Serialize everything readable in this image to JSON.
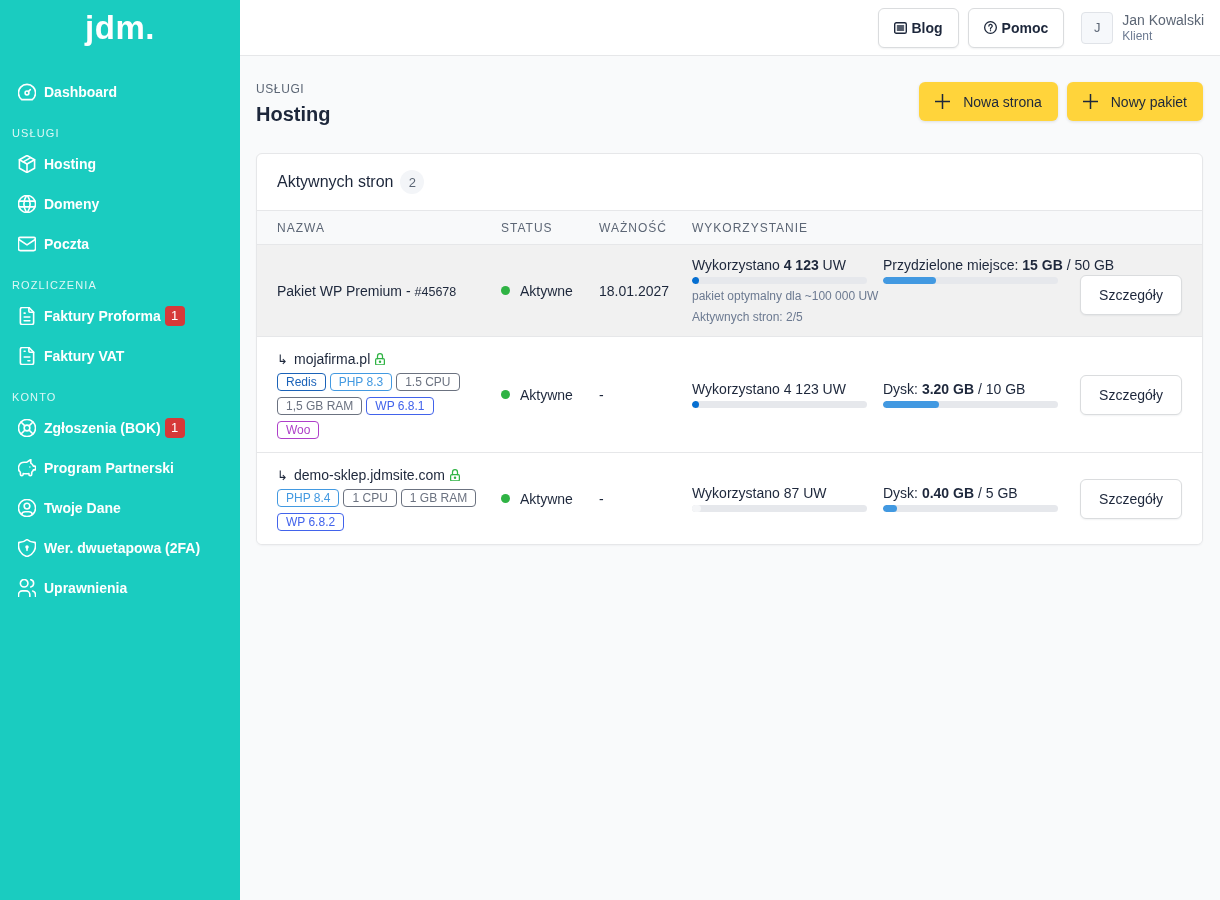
{
  "sidebar": {
    "logo": "jdm.",
    "sections": [
      {
        "items": [
          {
            "label": "Dashboard"
          }
        ]
      },
      {
        "title": "USŁUGI",
        "items": [
          {
            "label": "Hosting"
          },
          {
            "label": "Domeny"
          },
          {
            "label": "Poczta"
          }
        ]
      },
      {
        "title": "ROZLICZENIA",
        "items": [
          {
            "label": "Faktury Proforma",
            "badge": "1"
          },
          {
            "label": "Faktury VAT"
          }
        ]
      },
      {
        "title": "KONTO",
        "items": [
          {
            "label": "Zgłoszenia (BOK)",
            "badge": "1"
          },
          {
            "label": "Program Partnerski"
          },
          {
            "label": "Twoje Dane"
          },
          {
            "label": "Wer. dwuetapowa (2FA)"
          },
          {
            "label": "Uprawnienia"
          }
        ]
      }
    ]
  },
  "header": {
    "buttons": [
      {
        "label": "Blog"
      },
      {
        "label": "Pomoc"
      }
    ],
    "user": {
      "initial": "J",
      "name": "Jan Kowalski",
      "role": "Klient"
    }
  },
  "page": {
    "pretitle": "USŁUGI",
    "title": "Hosting",
    "actions": [
      {
        "label": "Nowa strona"
      },
      {
        "label": "Nowy pakiet"
      }
    ]
  },
  "card": {
    "title": "Aktywnych stron",
    "count": "2",
    "table": {
      "columns": [
        "NAZWA",
        "STATUS",
        "WAŻNOŚĆ",
        "WYKORZYSTANIE"
      ],
      "rows": [
        {
          "kind": "package",
          "name": "Pakiet WP Premium -",
          "id": "#45678",
          "status": {
            "label": "Aktywne",
            "color": "#2fb344"
          },
          "expiry": "18.01.2027",
          "usage": {
            "text": "Wykorzystano **4 123** UW",
            "level": 0.04,
            "color": "#066fd1",
            "notes": [
              "pakiet optymalny dla ~100 000 UW",
              "Aktywnych stron: 2/5"
            ]
          },
          "disk": {
            "text": "Przydzielone miejsce: **15 GB** / 50 GB",
            "level": 0.3
          },
          "action": "Szczegóły"
        },
        {
          "kind": "site",
          "arrow": "↳",
          "name": "mojafirma.pl",
          "ssl": true,
          "tags": [
            {
              "label": "Redis",
              "color": "#1a62b8"
            },
            {
              "label": "PHP 8.3",
              "color": "#4299e1"
            },
            {
              "label": "1.5 CPU",
              "color": "#6b7280"
            },
            {
              "label": "1,5 GB RAM",
              "color": "#6b7280"
            },
            {
              "label": "WP 6.8.1",
              "color": "#4263eb"
            },
            {
              "label": "Woo",
              "color": "#ae3ec9"
            }
          ],
          "status": {
            "label": "Aktywne",
            "color": "#2fb344"
          },
          "expiry": "-",
          "usage": {
            "text": "Wykorzystano 4 123 UW",
            "level": 0.04,
            "color": "#066fd1"
          },
          "disk": {
            "text": "Dysk: **3.20 GB** / 10 GB",
            "level": 0.32
          },
          "action": "Szczegóły"
        },
        {
          "kind": "site",
          "arrow": "↳",
          "name": "demo-sklep.jdmsite.com",
          "ssl": true,
          "tags": [
            {
              "label": "PHP 8.4",
              "color": "#4299e1"
            },
            {
              "label": "1 CPU",
              "color": "#6b7280"
            },
            {
              "label": "1 GB RAM",
              "color": "#6b7280"
            },
            {
              "label": "WP 6.8.2",
              "color": "#4263eb"
            }
          ],
          "status": {
            "label": "Aktywne",
            "color": "#2fb344"
          },
          "expiry": "-",
          "usage": {
            "text": "Wykorzystano 87 UW",
            "level": 0.05,
            "color": "#f5f6f8"
          },
          "disk": {
            "text": "Dysk: **0.40 GB** / 5 GB",
            "level": 0.08
          },
          "action": "Szczegóły"
        }
      ]
    }
  }
}
